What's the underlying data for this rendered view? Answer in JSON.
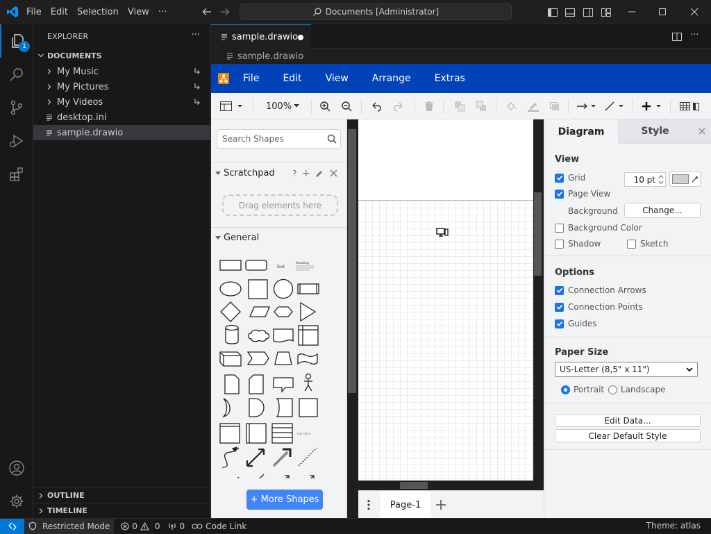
{
  "titlebar": {
    "menu": [
      "File",
      "Edit",
      "Selection",
      "View"
    ],
    "more": "···",
    "command_center": "Documents [Administrator]"
  },
  "activity": {
    "explorer_badge": "1"
  },
  "sidebar": {
    "title": "EXPLORER",
    "more": "···",
    "section": "DOCUMENTS",
    "items": [
      {
        "label": "My Music",
        "type": "folder"
      },
      {
        "label": "My Pictures",
        "type": "folder"
      },
      {
        "label": "My Videos",
        "type": "folder"
      },
      {
        "label": "desktop.ini",
        "type": "file"
      },
      {
        "label": "sample.drawio",
        "type": "file",
        "selected": true
      }
    ],
    "outline": "OUTLINE",
    "timeline": "TIMELINE"
  },
  "editor": {
    "tab_label": "sample.drawio",
    "dirty": true,
    "breadcrumb": "sample.drawio"
  },
  "drawio": {
    "menu": [
      "File",
      "Edit",
      "View",
      "Arrange",
      "Extras"
    ],
    "zoom": "100%",
    "search_placeholder": "Search Shapes",
    "scratchpad": "Scratchpad",
    "scratchpad_tools": [
      "?",
      "+"
    ],
    "drag_hint": "Drag elements here",
    "general": "General",
    "shape_text_sample": "Text",
    "shape_heading_sample": "Heading",
    "shape_list_sample": "List Item",
    "more_shapes": "+ More Shapes",
    "page_tab": "Page-1",
    "format": {
      "tab_diagram": "Diagram",
      "tab_style": "Style",
      "view_heading": "View",
      "grid_label": "Grid",
      "grid_checked": true,
      "grid_size": "10 pt",
      "page_view_label": "Page View",
      "page_view_checked": true,
      "background_label": "Background",
      "change_button": "Change...",
      "background_color_label": "Background Color",
      "background_color_checked": false,
      "shadow_label": "Shadow",
      "shadow_checked": false,
      "sketch_label": "Sketch",
      "sketch_checked": false,
      "options_heading": "Options",
      "connection_arrows_label": "Connection Arrows",
      "connection_arrows_checked": true,
      "connection_points_label": "Connection Points",
      "connection_points_checked": true,
      "guides_label": "Guides",
      "guides_checked": true,
      "paper_size_heading": "Paper Size",
      "paper_size_value": "US-Letter (8,5\" x 11\")",
      "portrait_label": "Portrait",
      "landscape_label": "Landscape",
      "orientation": "portrait",
      "edit_data_button": "Edit Data...",
      "clear_style_button": "Clear Default Style"
    }
  },
  "statusbar": {
    "restricted": "Restricted Mode",
    "errors": "0",
    "warnings": "0",
    "ports": "0",
    "code_link": "Code Link",
    "theme": "Theme: atlas"
  },
  "colors": {
    "vscode_accent": "#0078d4",
    "drawio_menu": "#0043b9",
    "checkbox": "#1a73e8",
    "more_shapes": "#4285f4"
  }
}
